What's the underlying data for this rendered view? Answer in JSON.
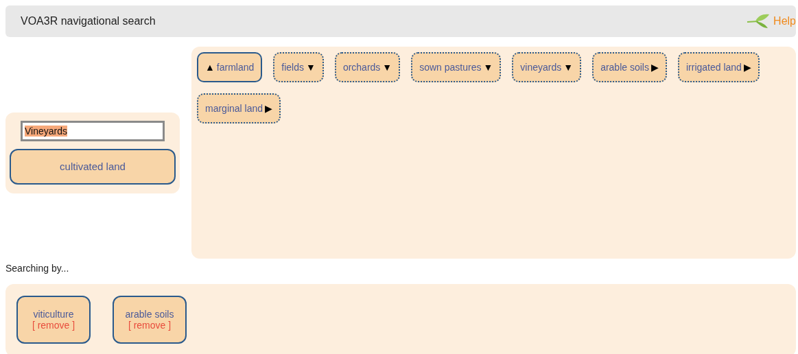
{
  "header": {
    "title": "VOA3R navigational search",
    "help": "Help"
  },
  "search": {
    "value": "Vineyards",
    "selected_text": true
  },
  "current_term": "cultivated land",
  "terms": [
    {
      "label": "farmland",
      "kind": "broader",
      "arrow": "▲"
    },
    {
      "label": "fields",
      "kind": "narrower",
      "arrow": "▼"
    },
    {
      "label": "orchards",
      "kind": "narrower",
      "arrow": "▼"
    },
    {
      "label": "sown pastures",
      "kind": "narrower",
      "arrow": "▼"
    },
    {
      "label": "vineyards",
      "kind": "narrower",
      "arrow": "▼"
    },
    {
      "label": "arable soils",
      "kind": "related",
      "arrow": "▶"
    },
    {
      "label": "irrigated land",
      "kind": "related",
      "arrow": "▶"
    },
    {
      "label": "marginal land",
      "kind": "related",
      "arrow": "▶"
    }
  ],
  "searching_label": "Searching by...",
  "filters": [
    {
      "label": "viticulture",
      "action": "[ remove ]"
    },
    {
      "label": "arable soils",
      "action": "[ remove ]"
    }
  ]
}
